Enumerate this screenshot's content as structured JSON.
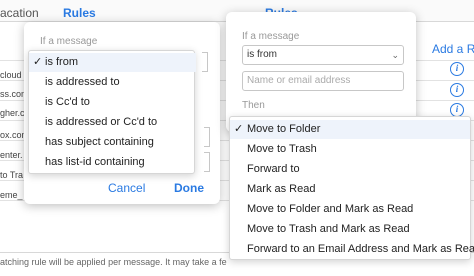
{
  "tabs": {
    "vacation": "acation",
    "rules_left": "Rules",
    "rules_right": "Rules"
  },
  "add_rule": "Add a Ru",
  "addresses": [
    "cloud",
    "ss.com",
    "gher.co",
    "ox.com",
    "enter.",
    "to Tra",
    "eme_"
  ],
  "info_icon_glyph": "i",
  "footer": "atching rule will be applied per message. It may take a fe",
  "left_popover": {
    "condition_label": "If a message",
    "cancel": "Cancel",
    "done": "Done"
  },
  "left_menu": {
    "check_glyph": "✓",
    "items": [
      "is from",
      "is addressed to",
      "is Cc'd to",
      "is addressed or Cc'd to",
      "has subject containing",
      "has list-id containing"
    ],
    "selected": "is from"
  },
  "right_popover": {
    "condition_label": "If a message",
    "select_value": "is from",
    "chevron": "⌄",
    "input_placeholder": "Name or email address",
    "then_label": "Then"
  },
  "right_menu": {
    "check_glyph": "✓",
    "items": [
      "Move to Folder",
      "Move to Trash",
      "Forward to",
      "Mark as Read",
      "Move to Folder and Mark as Read",
      "Move to Trash and Mark as Read",
      "Forward to an Email Address and Mark as Read"
    ],
    "selected": "Move to Folder"
  },
  "colors": {
    "accent": "#2a7ae2",
    "menu_selected_bg": "#eef3fb"
  }
}
